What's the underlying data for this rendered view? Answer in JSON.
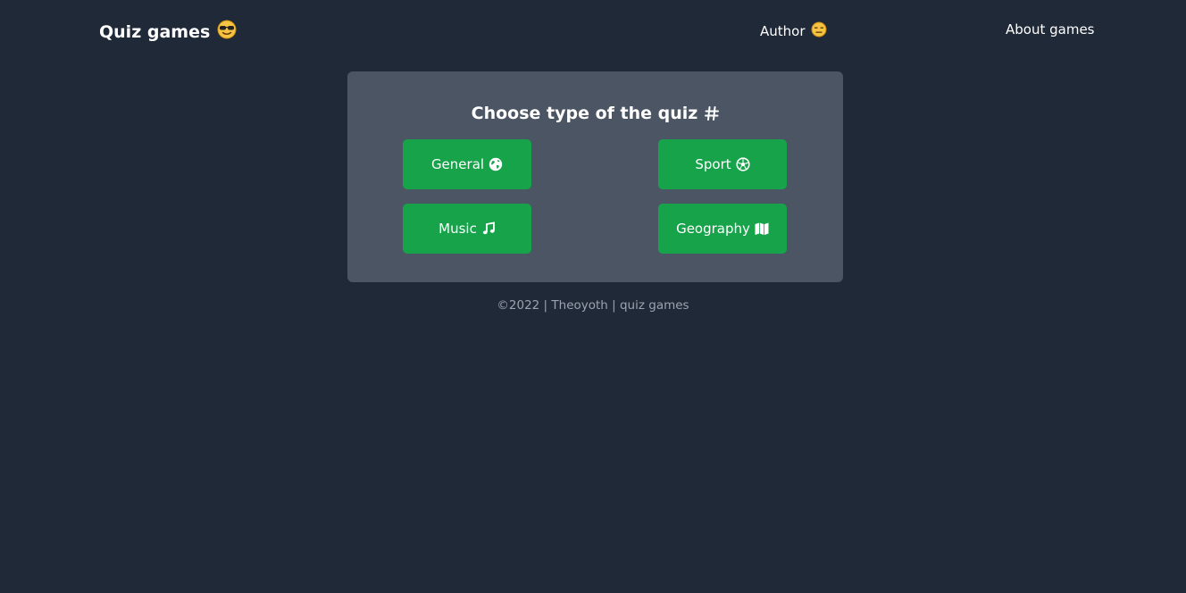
{
  "nav": {
    "brand": "Quiz games",
    "brand_icon": "sunglasses-emoji-icon",
    "author": "Author",
    "author_icon": "expressionless-emoji-icon",
    "about": "About games"
  },
  "panel": {
    "title": "Choose type of the quiz",
    "title_icon": "hashtag-icon",
    "buttons": [
      {
        "label": "General",
        "icon": "globe-icon"
      },
      {
        "label": "Sport",
        "icon": "soccer-ball-icon"
      },
      {
        "label": "Music",
        "icon": "music-note-icon"
      },
      {
        "label": "Geography",
        "icon": "map-icon"
      }
    ]
  },
  "footer": "©2022 | Theoyoth | quiz games",
  "colors": {
    "background": "#202938",
    "panel": "#4b5563",
    "button": "#16a34a",
    "footer_text": "#9ca3af"
  }
}
